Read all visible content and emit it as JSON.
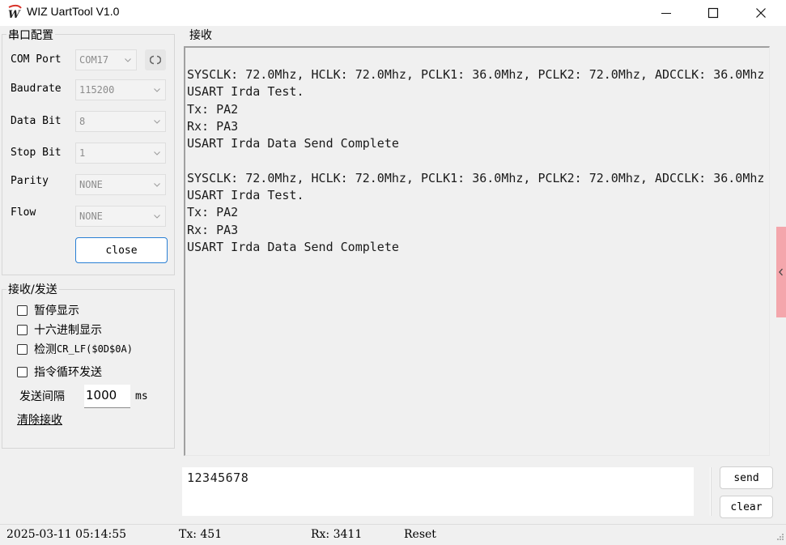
{
  "window": {
    "title": "WIZ UartTool V1.0",
    "logo_letter": "W"
  },
  "serial_config": {
    "group_title": "串口配置",
    "com_port": {
      "label": "COM Port",
      "value": "COM17"
    },
    "baudrate": {
      "label": "Baudrate",
      "value": "115200"
    },
    "data_bit": {
      "label": "Data Bit",
      "value": "8"
    },
    "stop_bit": {
      "label": "Stop Bit",
      "value": "1"
    },
    "parity": {
      "label": "Parity",
      "value": "NONE"
    },
    "flow": {
      "label": "Flow",
      "value": "NONE"
    },
    "close_label": "close"
  },
  "rx_tx_options": {
    "group_title": "接收/发送",
    "pause_display": "暂停显示",
    "hex_display": "十六进制显示",
    "detect_crlf_prefix": "检测",
    "detect_crlf_suffix": "CR_LF($0D$0A)",
    "loop_send": "指令循环发送",
    "interval_label": "发送间隔",
    "interval_value": "1000",
    "interval_unit": "ms",
    "clear_receive": "清除接收"
  },
  "receive": {
    "group_title": "接收",
    "text": "SYSCLK: 72.0Mhz, HCLK: 72.0Mhz, PCLK1: 36.0Mhz, PCLK2: 72.0Mhz, ADCCLK: 36.0Mhz\nUSART Irda Test.\nTx: PA2\nRx: PA3\nUSART Irda Data Send Complete\n\nSYSCLK: 72.0Mhz, HCLK: 72.0Mhz, PCLK1: 36.0Mhz, PCLK2: 72.0Mhz, ADCCLK: 36.0Mhz\nUSART Irda Test.\nTx: PA2\nRx: PA3\nUSART Irda Data Send Complete"
  },
  "send": {
    "input_value": "12345678",
    "send_label": "send",
    "clear_label": "clear"
  },
  "status": {
    "datetime": "2025-03-11 05:14:55",
    "tx": "Tx: 451",
    "rx": "Rx: 3411",
    "reset": "Reset"
  },
  "colors": {
    "accent_border": "#2a7fd4",
    "side_handle": "#f4a6ac",
    "logo_red": "#d9342b"
  }
}
